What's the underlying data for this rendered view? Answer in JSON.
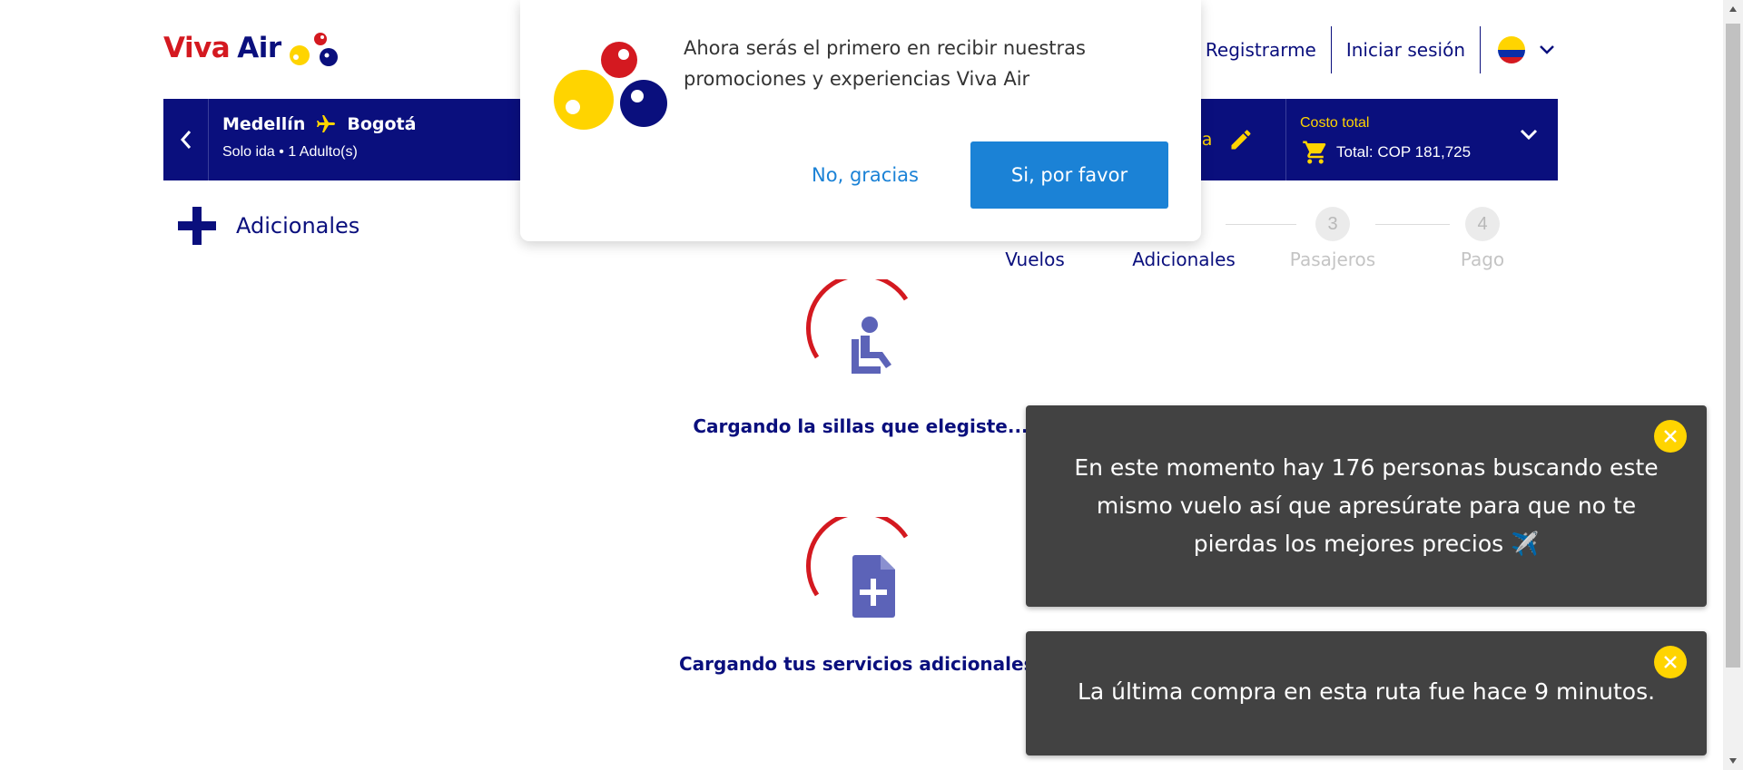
{
  "brand": {
    "viva": "Viva",
    "air": "Air"
  },
  "header": {
    "register": "Registrarme",
    "login": "Iniciar sesión",
    "language_flag": "colombia-flag"
  },
  "flight": {
    "origin": "Medellín",
    "destination": "Bogotá",
    "details": "Solo ida • 1 Adulto(s)",
    "edit_label_partial": "eda",
    "total_label": "Costo total",
    "total_value": "Total: COP 181,725"
  },
  "page": {
    "title": "Adicionales"
  },
  "steps": [
    {
      "num": "",
      "label": "Vuelos",
      "state": "done"
    },
    {
      "num": "",
      "label": "Adicionales",
      "state": "done"
    },
    {
      "num": "3",
      "label": "Pasajeros",
      "state": "pending"
    },
    {
      "num": "4",
      "label": "Pago",
      "state": "pending"
    }
  ],
  "loaders": [
    {
      "text": "Cargando la sillas que elegiste...",
      "icon": "seat-icon"
    },
    {
      "text": "Cargando tus servicios adicionales...",
      "icon": "add-document-icon"
    }
  ],
  "popup": {
    "message": "Ahora serás el primero en recibir nuestras promociones y experiencias Viva Air",
    "decline": "No, gracias",
    "accept": "Si, por favor"
  },
  "toasts": [
    {
      "text": "En este momento hay 176 personas buscando este mismo vuelo así que apresúrate para que no te pierdas los mejores precios ✈️"
    },
    {
      "text": "La última compra en esta ruta fue hace 9 minutos."
    }
  ],
  "colors": {
    "brand_blue": "#0a0f7d",
    "brand_red": "#d41920",
    "brand_yellow": "#ffd400",
    "cta_blue": "#1b82d6",
    "toast_bg": "#424242",
    "icon_purple": "#5c63b8"
  }
}
